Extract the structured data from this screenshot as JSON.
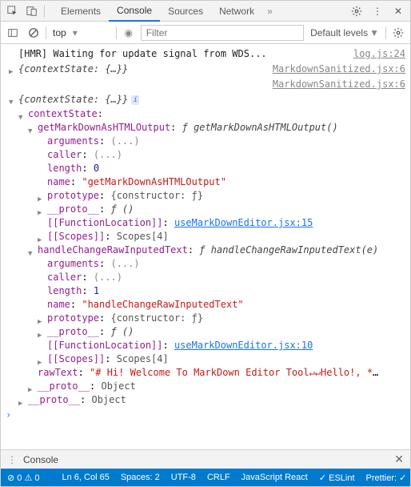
{
  "tabs": {
    "t0": "Elements",
    "t1": "Console",
    "t2": "Sources",
    "t3": "Network"
  },
  "subbar": {
    "context": "top",
    "filter_placeholder": "Filter",
    "levels": "Default levels"
  },
  "log": {
    "hmr": "[HMR] Waiting for update signal from WDS...",
    "hmr_src": "log.js:24",
    "ctx_collapsed": "{contextState: {…}}",
    "ctx_src": "MarkdownSanitized.jsx:6",
    "ctx_src2": "MarkdownSanitized.jsx:6",
    "root": "{contextState: {…}}",
    "cs_label": "contextState",
    "fn1_name": "getMarkDownAsHTMLOutput",
    "fn1_sig": "ƒ getMarkDownAsHTMLOutput()",
    "fn1_args": "arguments",
    "fn1_args_v": "(...)",
    "fn1_caller": "caller",
    "fn1_caller_v": "(...)",
    "fn1_len": "length",
    "fn1_len_v": "0",
    "fn1_nm": "name",
    "fn1_nm_v": "\"getMarkDownAsHTMLOutput\"",
    "fn1_proto": "prototype",
    "fn1_proto_v": "{constructor: ƒ}",
    "fn1_dproto": "__proto__",
    "fn1_dproto_v": "ƒ ()",
    "fn1_loc": "[[FunctionLocation]]",
    "fn1_loc_v": "useMarkDownEditor.jsx:15",
    "fn1_scopes": "[[Scopes]]",
    "fn1_scopes_v": "Scopes[4]",
    "fn2_name": "handleChangeRawInputedText",
    "fn2_sig": "ƒ handleChangeRawInputedText(e)",
    "fn2_args": "arguments",
    "fn2_args_v": "(...)",
    "fn2_caller": "caller",
    "fn2_caller_v": "(...)",
    "fn2_len": "length",
    "fn2_len_v": "1",
    "fn2_nm": "name",
    "fn2_nm_v": "\"handleChangeRawInputedText\"",
    "fn2_proto": "prototype",
    "fn2_proto_v": "{constructor: ƒ}",
    "fn2_dproto": "__proto__",
    "fn2_dproto_v": "ƒ ()",
    "fn2_loc": "[[FunctionLocation]]",
    "fn2_loc_v": "useMarkDownEditor.jsx:10",
    "fn2_scopes": "[[Scopes]]",
    "fn2_scopes_v": "Scopes[4]",
    "raw_label": "rawText",
    "raw_value": "\"# Hi! Welcome To MarkDown Editor Tool↵↵Hello!, **Evero…",
    "proto_label": "__proto__",
    "proto_val": "Object"
  },
  "drawer": {
    "title": "Console"
  },
  "status": {
    "err": "0",
    "warn": "0",
    "pos": "Ln 6, Col 65",
    "spaces": "Spaces: 2",
    "enc": "UTF-8",
    "eol": "CRLF",
    "lang": "JavaScript React",
    "eslint": "ESLint",
    "prettier": "Prettier: ✓"
  }
}
